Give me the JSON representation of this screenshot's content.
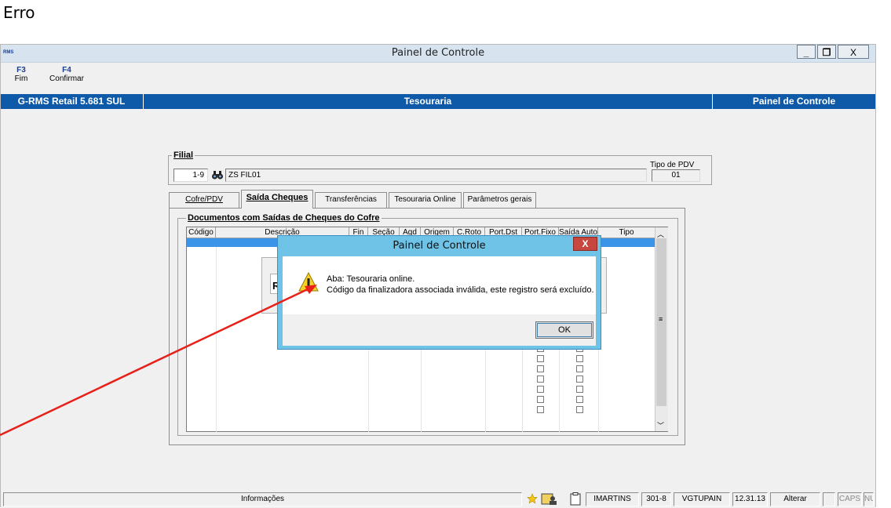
{
  "caption": "Erro",
  "window": {
    "app_logo": "RMS",
    "title": "Painel de Controle",
    "min_label": "_",
    "max_label": "❐",
    "close_label": "X"
  },
  "toolbar": {
    "f3_code": "F3",
    "f3_label": "Fim",
    "f4_code": "F4",
    "f4_label": "Confirmar"
  },
  "header_band": {
    "left": "G-RMS Retail 5.681 SUL",
    "center": "Tesouraria",
    "right": "Painel de Controle"
  },
  "filial": {
    "group_label": "Filial",
    "code_value": "1-9",
    "name_value": "ZS FIL01",
    "pdv_type_label": "Tipo de PDV",
    "pdv_type_value": "01"
  },
  "tabs": [
    {
      "label": "Cofre/PDV"
    },
    {
      "label": "Saída Cheques"
    },
    {
      "label": "Transferências"
    },
    {
      "label": "Tesouraria Online"
    },
    {
      "label": "Parâmetros gerais"
    }
  ],
  "documents": {
    "group_label": "Documentos com Saídas de Cheques do Cofre",
    "columns": [
      "Código",
      "Descrição",
      "Fin",
      "Seção",
      "Agd",
      "Origem",
      "C.Roto",
      "Port.Dst",
      "Port.Fixo",
      "Saída Auto",
      "Tipo"
    ],
    "hidden_label_fragment": "R"
  },
  "statusbar": {
    "info_label": "Informações",
    "user": "IMARTINS",
    "store": "301-8",
    "host": "VGTUPAIN",
    "version": "12.31.13",
    "mode": "Alterar",
    "caps": "CAPS",
    "num": "NUM"
  },
  "dialog": {
    "title": "Painel de Controle",
    "close_label": "X",
    "line1": "Aba: Tesouraria online.",
    "line2": "Código da finalizadora associada inválida, este registro será excluído.",
    "ok_label": "OK",
    "warning_icon": "warning-triangle-icon"
  },
  "annotation": {
    "color": "#e8201a"
  }
}
